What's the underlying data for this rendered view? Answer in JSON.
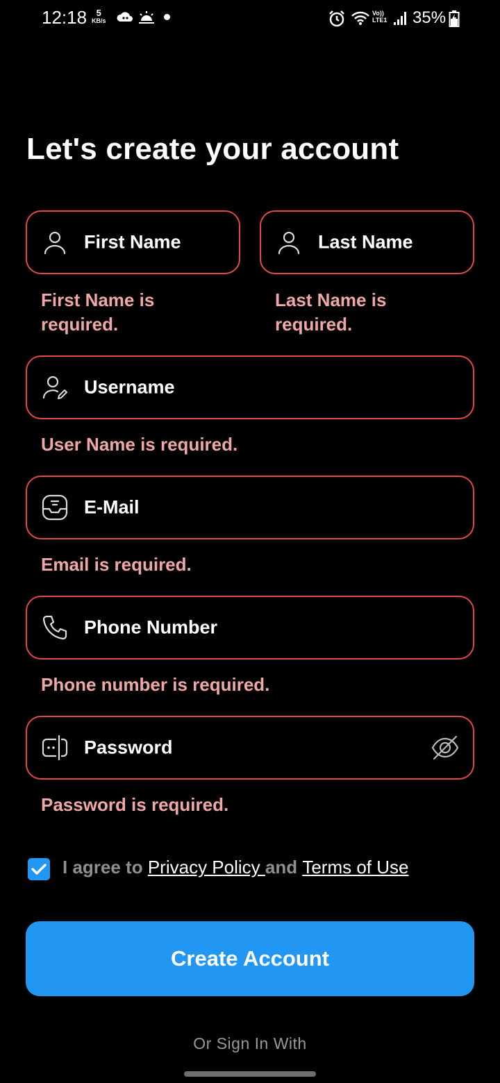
{
  "status_bar": {
    "time": "12:18",
    "speed_value": "5",
    "speed_unit": "KB/s",
    "network_label": "Vo)) LTE1",
    "battery": "35%"
  },
  "title": "Let's create your account",
  "fields": {
    "first_name": {
      "label": "First Name",
      "error": "First Name is required."
    },
    "last_name": {
      "label": "Last Name",
      "error": "Last Name is required."
    },
    "username": {
      "label": "Username",
      "error": "User Name is required."
    },
    "email": {
      "label": "E-Mail",
      "error": "Email is required."
    },
    "phone": {
      "label": "Phone Number",
      "error": "Phone number is required."
    },
    "password": {
      "label": "Password",
      "error": "Password is required."
    }
  },
  "agreement": {
    "checked": true,
    "prefix": "I agree to ",
    "privacy_link": "Privacy Policy ",
    "conjunction": "and ",
    "terms_link": "Terms of Use"
  },
  "create_button": "Create Account",
  "divider": "Or Sign In With",
  "colors": {
    "background": "#000000",
    "error_border": "#e24b45",
    "error_text": "#f0a8a6",
    "primary": "#2196f3"
  },
  "icons": {
    "first_name": "user-icon",
    "last_name": "user-icon",
    "username": "user-edit-icon",
    "email": "inbox-icon",
    "phone": "phone-icon",
    "password": "password-check-icon",
    "password_toggle": "eye-slash-icon"
  }
}
